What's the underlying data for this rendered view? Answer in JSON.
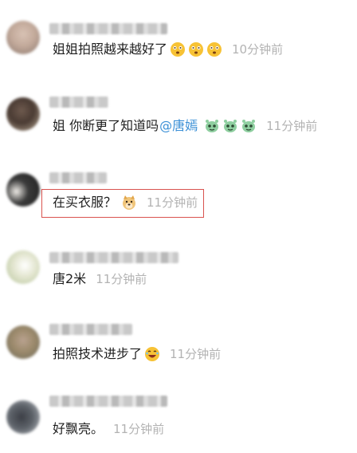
{
  "comments": [
    {
      "text": "姐姐拍照越来越好了",
      "emoji_icons": [
        "flushed-emoji-icon",
        "flushed-emoji-icon",
        "flushed-emoji-icon"
      ],
      "time": "10分钟前"
    },
    {
      "text": "姐 你断更了知道吗",
      "mention": "@唐嫣",
      "emoji_icons": [
        "alien-emoji-icon",
        "alien-emoji-icon",
        "alien-emoji-icon"
      ],
      "time": "11分钟前"
    },
    {
      "text": "在买衣服？",
      "emoji_icons": [
        "doge-emoji-icon"
      ],
      "time": "11分钟前"
    },
    {
      "text": "唐2米",
      "time": "11分钟前"
    },
    {
      "text": "拍照技术进步了",
      "emoji_icons": [
        "laughing-emoji-icon"
      ],
      "time": "11分钟前"
    },
    {
      "text": "好飘亮。",
      "time": "11分钟前"
    }
  ],
  "colors": {
    "text": "#1f1f1f",
    "time": "#b3b3b3",
    "mention": "#3a8fd6",
    "highlight_border": "#d9534f"
  }
}
